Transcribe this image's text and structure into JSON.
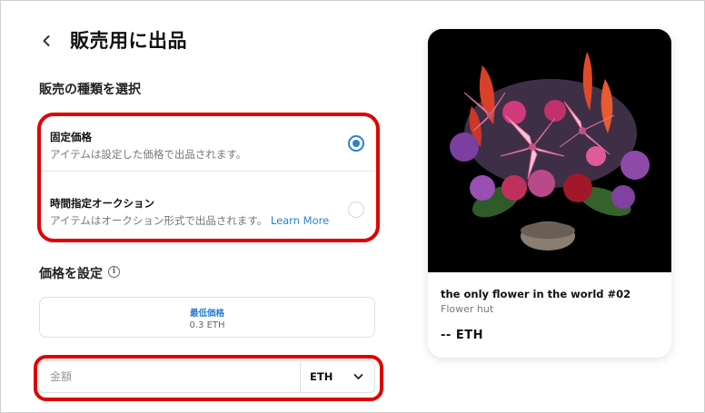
{
  "header": {
    "title": "販売用に出品",
    "back_icon": "chevron-left-icon"
  },
  "sale_type": {
    "heading": "販売の種類を選択",
    "options": [
      {
        "title": "固定価格",
        "description": "アイテムは設定した価格で出品されます。",
        "link": "",
        "selected": true
      },
      {
        "title": "時間指定オークション",
        "description": "アイテムはオークション形式で出品されます。",
        "link": "Learn More",
        "selected": false
      }
    ]
  },
  "price": {
    "heading": "価格を設定",
    "info_icon_glyph": "i",
    "min_price_label": "最低価格",
    "min_price_value": "0.3 ETH",
    "amount_placeholder": "金額",
    "amount_value": "",
    "currency": "ETH",
    "currency_icon": "chevron-down-icon"
  },
  "preview": {
    "name": "the only flower in the world #02",
    "collection": "Flower hut",
    "price": "-- ETH"
  },
  "colors": {
    "accent": "#2d7fd3",
    "highlight": "#e00000"
  }
}
